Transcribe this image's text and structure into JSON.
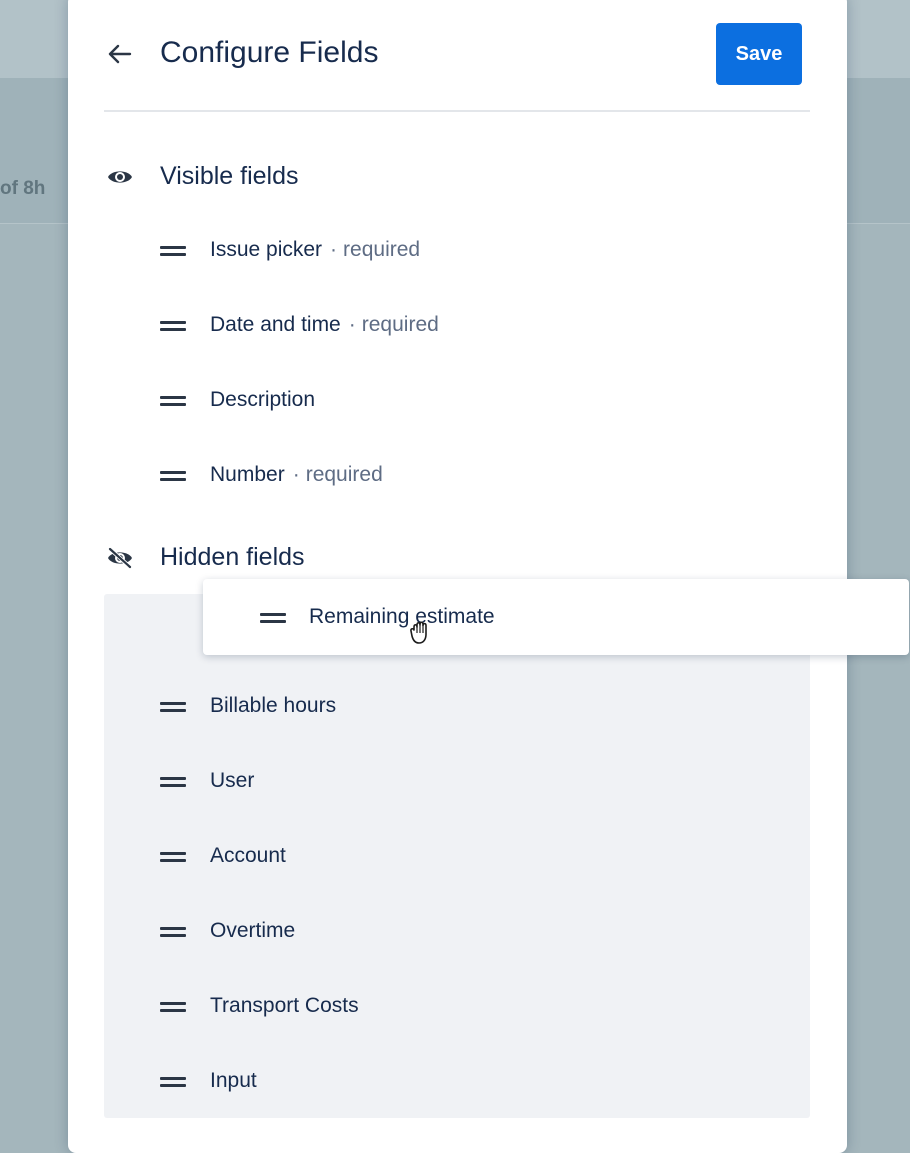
{
  "background": {
    "partial_text": "of 8h"
  },
  "header": {
    "back_icon": "arrow-left-icon",
    "title": "Configure Fields",
    "save_label": "Save"
  },
  "visible_section": {
    "icon": "eye-icon",
    "label": "Visible fields",
    "fields": [
      {
        "label": "Issue picker",
        "tag": "required"
      },
      {
        "label": "Date and time",
        "tag": "required"
      },
      {
        "label": "Description",
        "tag": ""
      },
      {
        "label": "Number",
        "tag": "required"
      }
    ]
  },
  "hidden_section": {
    "icon": "eye-off-icon",
    "label": "Hidden fields",
    "fields": [
      {
        "label": "Billable hours"
      },
      {
        "label": "User"
      },
      {
        "label": "Account"
      },
      {
        "label": "Overtime"
      },
      {
        "label": "Transport Costs"
      },
      {
        "label": "Input"
      }
    ]
  },
  "dragging_item": {
    "label": "Remaining estimate",
    "cursor_icon": "grabbing-hand-icon"
  },
  "colors": {
    "accent": "#0c6fe0",
    "text": "#172b4d",
    "muted": "#5e6c84",
    "hidden_area_bg": "#f0f2f5"
  }
}
